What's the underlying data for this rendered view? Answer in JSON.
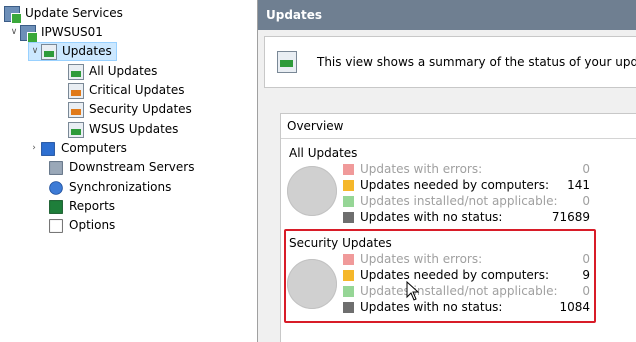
{
  "tree": {
    "root": "Update Services",
    "server": "IPWSUS01",
    "updates": "Updates",
    "all_updates": "All Updates",
    "critical_updates": "Critical Updates",
    "security_updates": "Security Updates",
    "wsus_updates": "WSUS Updates",
    "computers": "Computers",
    "downstream_servers": "Downstream Servers",
    "synchronizations": "Synchronizations",
    "reports": "Reports",
    "options": "Options"
  },
  "panel": {
    "title": "Updates",
    "description": "This view shows a summary of the status of your update"
  },
  "overview": {
    "heading": "Overview",
    "sections": [
      {
        "title": "All Updates",
        "rows": [
          {
            "label": "Updates with errors:",
            "value": "0",
            "color": "#f09a9a",
            "dim": true
          },
          {
            "label": "Updates needed by computers:",
            "value": "141",
            "color": "#f5b72a",
            "dim": false
          },
          {
            "label": "Updates installed/not applicable:",
            "value": "0",
            "color": "#96d696",
            "dim": true
          },
          {
            "label": "Updates with no status:",
            "value": "71689",
            "color": "#6e6e6e",
            "dim": false
          }
        ]
      },
      {
        "title": "Security Updates",
        "rows": [
          {
            "label": "Updates with errors:",
            "value": "0",
            "color": "#f09a9a",
            "dim": true
          },
          {
            "label": "Updates needed by computers:",
            "value": "9",
            "color": "#f5b72a",
            "dim": false
          },
          {
            "label": "Updates installed/not applicable:",
            "value": "0",
            "color": "#96d696",
            "dim": true
          },
          {
            "label": "Updates with no status:",
            "value": "1084",
            "color": "#6e6e6e",
            "dim": false
          }
        ]
      }
    ]
  },
  "colors": {
    "header_bg": "#6f7f91",
    "selection": "#cce8ff",
    "highlight_border": "#d81c28"
  }
}
